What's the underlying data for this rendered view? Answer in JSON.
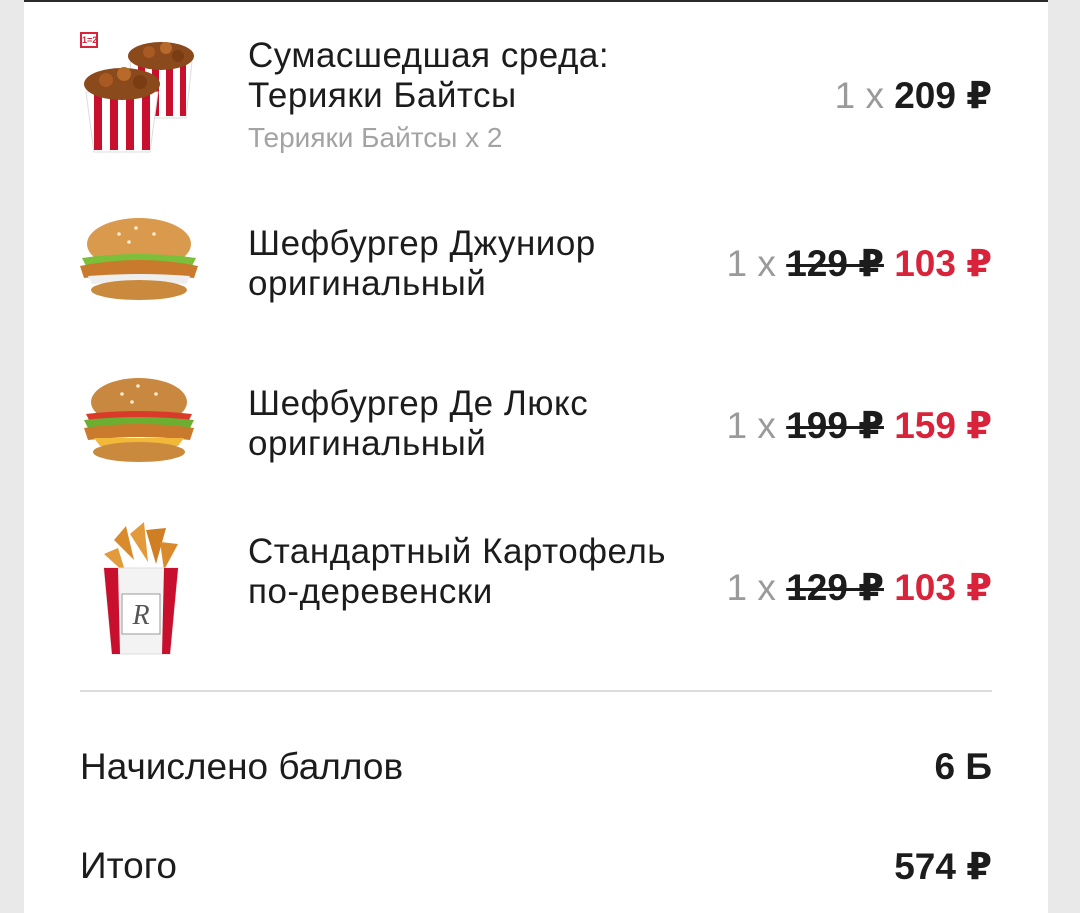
{
  "items": [
    {
      "name": "Сумасшедшая среда: Терияки Байтсы",
      "subtitle": "Терияки Байтсы x 2",
      "badge": "1=2",
      "qty": "1 x",
      "old_price": "",
      "price": "209 ₽",
      "discounted": false,
      "icon": "teriyaki-bites-buckets-icon"
    },
    {
      "name": "Шефбургер Джуниор оригинальный",
      "subtitle": "",
      "qty": "1 x",
      "old_price": "129 ₽",
      "price": "103 ₽",
      "discounted": true,
      "icon": "chef-burger-junior-icon"
    },
    {
      "name": "Шефбургер Де Люкс оригинальный",
      "subtitle": "",
      "qty": "1 x",
      "old_price": "199 ₽",
      "price": "159 ₽",
      "discounted": true,
      "icon": "chef-burger-deluxe-icon"
    },
    {
      "name": "Стандартный Картофель по-деревенски",
      "subtitle": "",
      "qty": "1 x",
      "old_price": "129 ₽",
      "price": "103 ₽",
      "discounted": true,
      "icon": "country-potatoes-icon"
    }
  ],
  "points": {
    "label": "Начислено баллов",
    "value": "6 Б"
  },
  "total": {
    "label": "Итого",
    "value": "574 ₽"
  },
  "colors": {
    "accent": "#d8233b",
    "muted": "#9a9a9a",
    "text": "#1c1c1c"
  }
}
